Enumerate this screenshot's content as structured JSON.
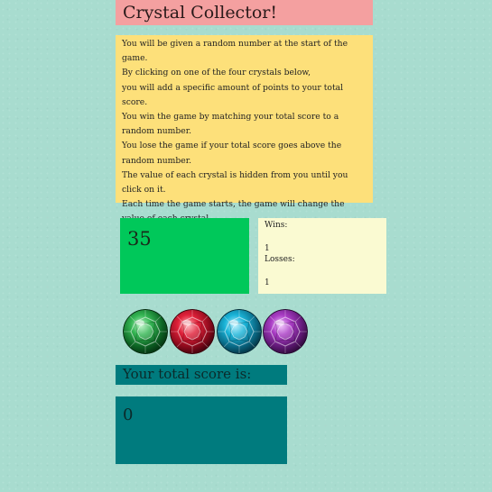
{
  "game": {
    "title": "Crystal Collector!"
  },
  "instructions": [
    "You will be given a random number at the start of the game.",
    "By clicking on one of the four crystals below,",
    "you will add a specific amount of points to your total score.",
    "You win the game by matching your total score to a random number.",
    "You lose the game if your total score goes above the random number.",
    "The value of each crystal is hidden from you until you click on it.",
    "Each time the game starts, the game will change the value of each crystal."
  ],
  "target": {
    "value": "35"
  },
  "stats": {
    "wins_label": "Wins:",
    "wins_value": "1",
    "losses_label": "Losses:",
    "losses_value": "1"
  },
  "crystals": [
    {
      "icon": "green-crystal-icon",
      "color": "#1f9e3a"
    },
    {
      "icon": "red-crystal-icon",
      "color": "#c8102e"
    },
    {
      "icon": "blue-crystal-icon",
      "color": "#14a3c7"
    },
    {
      "icon": "purple-crystal-icon",
      "color": "#9b2bb0"
    }
  ],
  "score": {
    "label": "Your total score is:",
    "value": "0"
  },
  "colors": {
    "background": "#a8dccf",
    "title_bg": "#f4a0a0",
    "instructions_bg": "#fde07a",
    "target_bg": "#00c85a",
    "stats_bg": "#fafad2",
    "score_bg": "#007b7e"
  }
}
